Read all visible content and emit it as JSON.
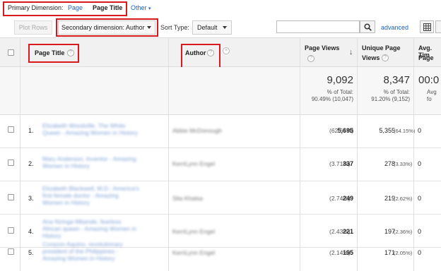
{
  "primary_dimension": {
    "label": "Primary Dimension:",
    "page": "Page",
    "page_title": "Page Title",
    "other": "Other"
  },
  "toolbar": {
    "plot_rows": "Plot Rows",
    "secondary_dimension": "Secondary dimension: Author",
    "sort_type_label": "Sort Type:",
    "sort_type_value": "Default",
    "search_value": "",
    "advanced": "advanced"
  },
  "columns": {
    "page_title": "Page Title",
    "author": "Author",
    "page_views": "Page Views",
    "unique_page": "Unique Page",
    "views": "Views",
    "avg_time": "Avg. Tim",
    "avg_time_2": "Page"
  },
  "totals": {
    "page_views": "9,092",
    "page_views_pct_label": "% of Total:",
    "page_views_pct": "90.49% (10,047)",
    "unique_page_views": "8,347",
    "unique_pct_label": "% of Total:",
    "unique_pct": "91.20% (9,152)",
    "avg_time": "00:0",
    "avg_time_label": "Avg fo"
  },
  "rows": [
    {
      "num": "1.",
      "title_line1": "Elizabeth Woodville, The White",
      "title_line2": "Queen - Amazing Women in History",
      "title_line3": "",
      "author": "Abbie McDonough",
      "pv": "5,695",
      "pv_pct": "(62.64%)",
      "upv": "5,355",
      "upv_pct": "(64.15%)",
      "avg": "0"
    },
    {
      "num": "2.",
      "title_line1": "Mary Anderson, Inventor - Amazing",
      "title_line2": "Women in History",
      "title_line3": "",
      "author": "KerriLynn Engel",
      "pv": "337",
      "pv_pct": "(3.71%)",
      "upv": "278",
      "upv_pct": "(3.33%)",
      "avg": "0"
    },
    {
      "num": "3.",
      "title_line1": "Elizabeth Blackwell, M.D.: America's",
      "title_line2": "first female doctor - Amazing",
      "title_line3": "Women in History",
      "author": "Sita Khalsa",
      "pv": "249",
      "pv_pct": "(2.74%)",
      "upv": "219",
      "upv_pct": "(2.62%)",
      "avg": "0"
    },
    {
      "num": "4.",
      "title_line1": "Ana Nzinga Mbande, fearless",
      "title_line2": "African queen - Amazing Women in",
      "title_line3": "History",
      "author": "KerriLynn Engel",
      "pv": "221",
      "pv_pct": "(2.43%)",
      "upv": "197",
      "upv_pct": "(2.36%)",
      "avg": "0"
    },
    {
      "num": "5.",
      "title_line1": "Corazon Aquino, revolutionary",
      "title_line2": "president of the Philippines -",
      "title_line3": "Amazing Women in History",
      "author": "KerriLynn Engel",
      "pv": "195",
      "pv_pct": "(2.14%)",
      "upv": "171",
      "upv_pct": "(2.05%)",
      "avg": "0"
    }
  ],
  "icons": {
    "search": "search-icon",
    "grid": "grid-view-icon",
    "sort_arrow": "sort-down-arrow-icon",
    "help": "help-question-icon",
    "remove": "remove-dimension-icon"
  },
  "colors": {
    "highlight": "#d8191e",
    "link": "#1c62b9"
  }
}
